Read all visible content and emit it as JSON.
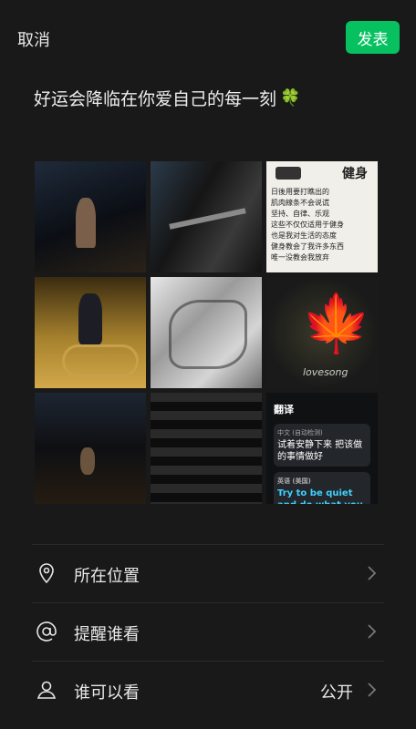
{
  "header": {
    "cancel_label": "取消",
    "publish_label": "发表"
  },
  "post": {
    "caption": "好运会降临在你爱自己的每一刻",
    "caption_emoji": "🍀"
  },
  "photos": {
    "p3_heading": "健身",
    "p3_lines": [
      "日後用要打瞧出的",
      "肌肉線条不会说谎",
      "坚持、自律、乐观",
      "这些不仅仅适用于健身",
      "也是我对生活的态度",
      "健身教会了我许多东西",
      "唯一没教会我放弃"
    ],
    "p6_text": "lovesong",
    "p9_title": "翻译",
    "p9_zh_label": "中文 (自动检测)",
    "p9_zh": "试着安静下来 把该做的事情做好",
    "p9_en_label": "英语 (美国)",
    "p9_en": "Try to be quiet and do what you have to do."
  },
  "options": [
    {
      "icon": "location-pin-icon",
      "label": "所在位置",
      "value": ""
    },
    {
      "icon": "at-sign-icon",
      "label": "提醒谁看",
      "value": ""
    },
    {
      "icon": "person-icon",
      "label": "谁可以看",
      "value": "公开"
    }
  ],
  "colors": {
    "background": "#191919",
    "accent": "#07c160"
  }
}
